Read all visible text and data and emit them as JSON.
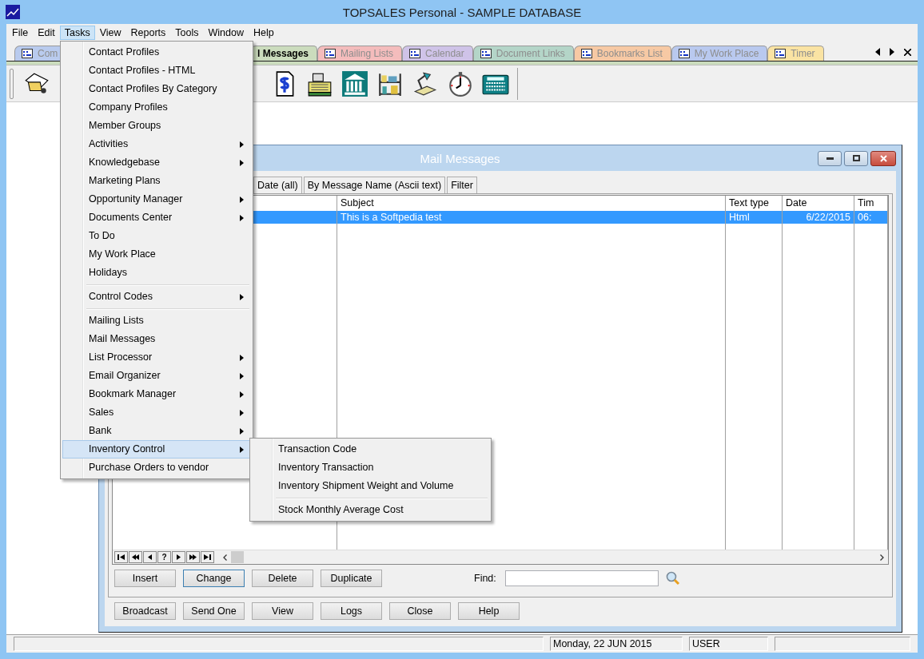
{
  "window": {
    "title": "TOPSALES Personal - SAMPLE DATABASE"
  },
  "menu_bar": [
    {
      "label": "File",
      "selected": false
    },
    {
      "label": "Edit",
      "selected": false
    },
    {
      "label": "Tasks",
      "selected": true
    },
    {
      "label": "View",
      "selected": false
    },
    {
      "label": "Reports",
      "selected": false
    },
    {
      "label": "Tools",
      "selected": false
    },
    {
      "label": "Window",
      "selected": false
    },
    {
      "label": "Help",
      "selected": false
    }
  ],
  "tabs": [
    {
      "label": "Com",
      "selected": false,
      "color": "#b9cbee",
      "icon": true
    },
    {
      "label": "l Messages",
      "selected": true,
      "color": "#cbdcbd",
      "icon": false
    },
    {
      "label": "Mailing Lists",
      "selected": false,
      "color": "#f4bcbc",
      "icon": true
    },
    {
      "label": "Calendar",
      "selected": false,
      "color": "#cfc3e8",
      "icon": true
    },
    {
      "label": "Document Links",
      "selected": false,
      "color": "#b4d5c8",
      "icon": true
    },
    {
      "label": "Bookmarks List",
      "selected": false,
      "color": "#f7c9a4",
      "icon": true
    },
    {
      "label": "My Work Place",
      "selected": false,
      "color": "#b9c9ef",
      "icon": true
    },
    {
      "label": "Timer",
      "selected": false,
      "color": "#fae3a3",
      "icon": true
    }
  ],
  "tasks_menu": [
    {
      "kind": "item",
      "label": "Contact Profiles",
      "submenu": false,
      "selected": false
    },
    {
      "kind": "item",
      "label": "Contact Profiles - HTML",
      "submenu": false,
      "selected": false
    },
    {
      "kind": "item",
      "label": "Contact Profiles By Category",
      "submenu": false,
      "selected": false
    },
    {
      "kind": "item",
      "label": "Company Profiles",
      "submenu": false,
      "selected": false
    },
    {
      "kind": "item",
      "label": "Member Groups",
      "submenu": false,
      "selected": false
    },
    {
      "kind": "item",
      "label": "Activities",
      "submenu": true,
      "selected": false
    },
    {
      "kind": "item",
      "label": "Knowledgebase",
      "submenu": true,
      "selected": false
    },
    {
      "kind": "item",
      "label": "Marketing Plans",
      "submenu": false,
      "selected": false
    },
    {
      "kind": "item",
      "label": "Opportunity Manager",
      "submenu": true,
      "selected": false
    },
    {
      "kind": "item",
      "label": "Documents Center",
      "submenu": true,
      "selected": false
    },
    {
      "kind": "item",
      "label": "To Do",
      "submenu": false,
      "selected": false
    },
    {
      "kind": "item",
      "label": "My Work Place",
      "submenu": false,
      "selected": false
    },
    {
      "kind": "item",
      "label": "Holidays",
      "submenu": false,
      "selected": false
    },
    {
      "kind": "separator"
    },
    {
      "kind": "item",
      "label": "Control Codes",
      "submenu": true,
      "selected": false
    },
    {
      "kind": "separator"
    },
    {
      "kind": "item",
      "label": "Mailing Lists",
      "submenu": false,
      "selected": false
    },
    {
      "kind": "item",
      "label": "Mail Messages",
      "submenu": false,
      "selected": false
    },
    {
      "kind": "item",
      "label": "List Processor",
      "submenu": true,
      "selected": false
    },
    {
      "kind": "item",
      "label": "Email Organizer",
      "submenu": true,
      "selected": false
    },
    {
      "kind": "item",
      "label": "Bookmark Manager",
      "submenu": true,
      "selected": false
    },
    {
      "kind": "item",
      "label": "Sales",
      "submenu": true,
      "selected": false
    },
    {
      "kind": "item",
      "label": "Bank",
      "submenu": true,
      "selected": false
    },
    {
      "kind": "item",
      "label": "Inventory Control",
      "submenu": true,
      "selected": true
    },
    {
      "kind": "item",
      "label": "Purchase Orders to vendor",
      "submenu": false,
      "selected": false
    }
  ],
  "submenu": [
    {
      "kind": "item",
      "label": "Transaction Code",
      "submenu": false,
      "selected": false
    },
    {
      "kind": "item",
      "label": "Inventory Transaction",
      "submenu": false,
      "selected": false
    },
    {
      "kind": "item",
      "label": "Inventory Shipment Weight and Volume",
      "submenu": false,
      "selected": false
    },
    {
      "kind": "separator"
    },
    {
      "kind": "item",
      "label": "Stock Monthly Average Cost",
      "submenu": false,
      "selected": false
    }
  ],
  "child_window": {
    "title": "Mail Messages",
    "tabs": [
      {
        "label": "Date (all)",
        "selected": false
      },
      {
        "label": "By Message Name (Ascii text)",
        "selected": false
      },
      {
        "label": "Filter",
        "selected": false
      }
    ],
    "columns": [
      {
        "label": "Subject",
        "kind": "text"
      },
      {
        "label": "Text type",
        "kind": "text"
      },
      {
        "label": "Date",
        "kind": "date"
      },
      {
        "label": "Tim",
        "kind": "text"
      }
    ],
    "rows": [
      {
        "selected": true,
        "cells": [
          "This is a Softpedia test",
          "Html",
          "6/22/2015",
          "06:"
        ]
      }
    ],
    "nav_help": "?",
    "buttons": [
      {
        "label": "Insert",
        "focused": false
      },
      {
        "label": "Change",
        "focused": true
      },
      {
        "label": "Delete",
        "focused": false
      },
      {
        "label": "Duplicate",
        "focused": false
      }
    ],
    "find_label": "Find:",
    "bottom_buttons": [
      "Broadcast",
      "Send One",
      "View",
      "Logs",
      "Close",
      "Help"
    ]
  },
  "status_bar": [
    "Monday, 22 JUN 2015",
    "USER"
  ]
}
